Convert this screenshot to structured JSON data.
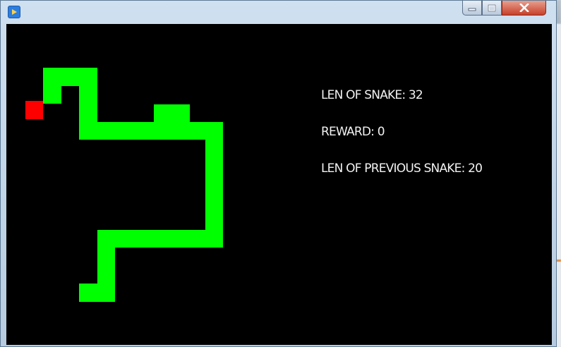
{
  "game": {
    "len_of_snake_label": "LEN OF SNAKE: 32",
    "reward_label": "REWARD: 0",
    "len_of_previous_snake_label": "LEN OF PREVIOUS SNAKE: 20",
    "len_of_snake": 32,
    "reward": 0,
    "len_of_previous_snake": 20
  },
  "colors": {
    "snake": "#00ff00",
    "food": "#ff0000",
    "background": "#000000",
    "text": "#ffffff"
  },
  "icons": {
    "app": "pygame-window-icon",
    "minimize": "minimize-icon",
    "maximize": "maximize-icon",
    "close": "close-icon"
  }
}
